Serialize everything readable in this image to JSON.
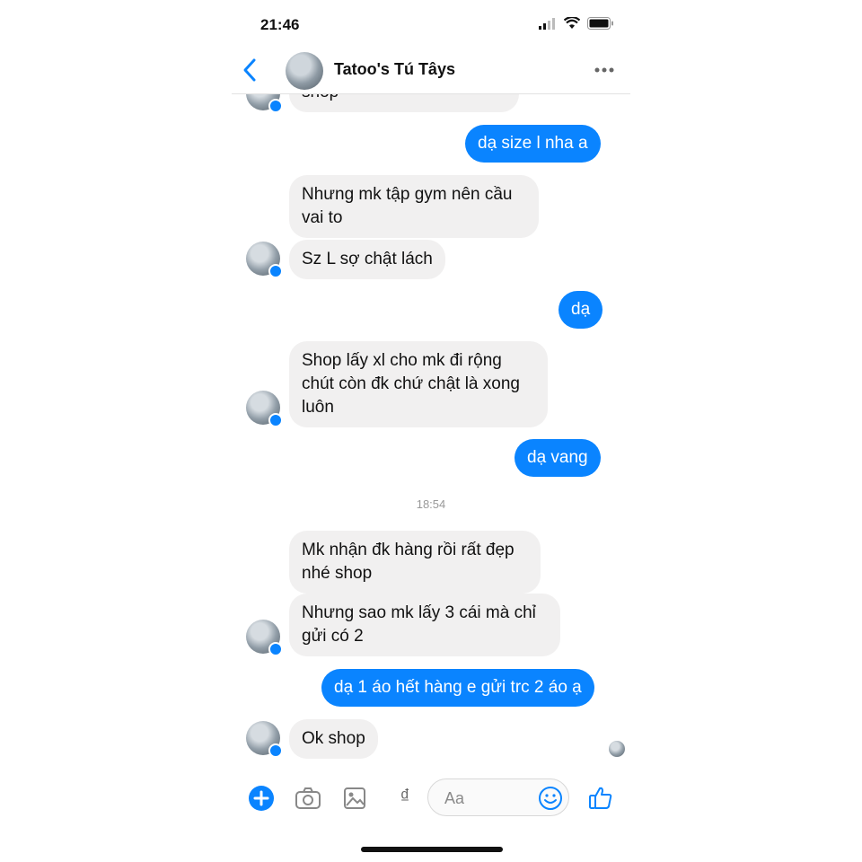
{
  "status": {
    "time": "21:46"
  },
  "header": {
    "contact_name": "Tatoo's Tú Tâys"
  },
  "messages": {
    "m0": "shop",
    "m1": "dạ size l nha a",
    "m2": "Nhưng mk tập gym nên cầu vai to",
    "m3": "Sz L sợ chật lách",
    "m4": "dạ",
    "m5": "Shop lấy xl cho mk đi rộng chút còn đk chứ chật là xong luôn",
    "m6": "dạ vang",
    "time": "18:54",
    "m7": "Mk nhận đk hàng rồi rất đẹp nhé shop",
    "m8": "Nhưng sao mk lấy 3 cái mà chỉ gửi có 2",
    "m9": "dạ 1 áo hết hàng e gửi trc 2 áo ạ",
    "m10": "Ok shop"
  },
  "composer": {
    "placeholder": "Aa",
    "currency_symbol": "₫"
  },
  "colors": {
    "accent": "#0a84ff",
    "incoming_bubble": "#f1f0f0"
  },
  "icons": [
    "back-chevron-icon",
    "more-dots-icon",
    "plus-icon",
    "camera-icon",
    "image-icon",
    "emoji-icon",
    "thumbs-up-icon",
    "messenger-badge-icon"
  ]
}
